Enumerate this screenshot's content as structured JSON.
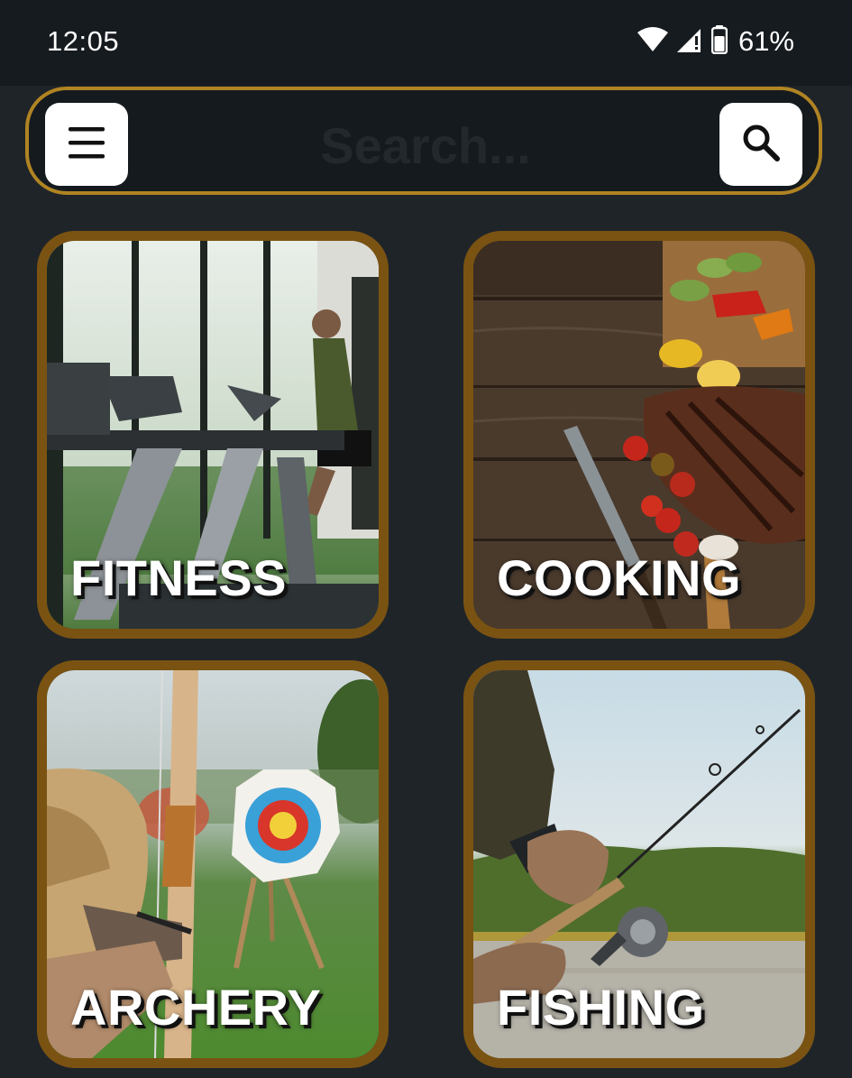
{
  "status_bar": {
    "time": "12:05",
    "battery_percent": "61%",
    "icons": [
      "wifi-icon",
      "cellular-signal-icon",
      "battery-icon"
    ]
  },
  "search": {
    "placeholder": "Search...",
    "menu_icon": "hamburger-menu-icon",
    "search_icon": "magnifier-icon"
  },
  "categories": [
    {
      "label": "FITNESS"
    },
    {
      "label": "COOKING"
    },
    {
      "label": "ARCHERY"
    },
    {
      "label": "FISHING"
    }
  ],
  "colors": {
    "background": "#1f2429",
    "status_bar": "#161b1f",
    "accent_gold": "#b08423",
    "card_border": "#7a5312"
  }
}
